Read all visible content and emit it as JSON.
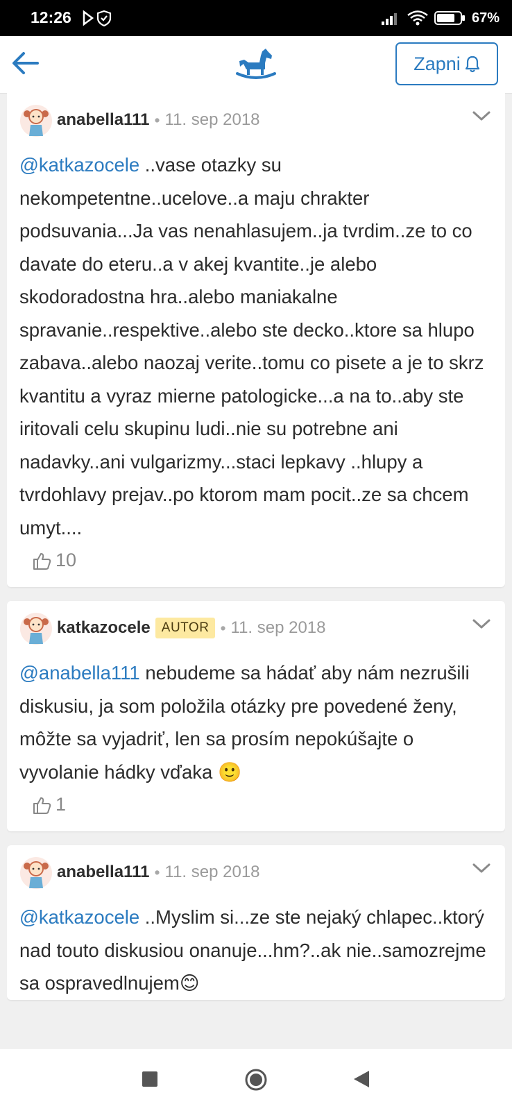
{
  "status_bar": {
    "time": "12:26",
    "battery": "67%"
  },
  "header": {
    "notify_label": "Zapni"
  },
  "comments": [
    {
      "username": "anabella111",
      "date": "11. sep 2018",
      "mention": "@katkazocele",
      "text": " ..vase otazky su nekompetentne..ucelove..a maju chrakter podsuvania...Ja vas nenahlasujem..ja tvrdim..ze to co davate do eteru..a v akej kvantite..je alebo skodoradostna hra..alebo maniakalne spravanie..respektive..alebo ste decko..ktore sa hlupo zabava..alebo naozaj verite..tomu co pisete a je to skrz kvantitu a vyraz mierne patologicke...a na to..aby ste iritovali celu skupinu ludi..nie su potrebne ani nadavky..ani vulgarizmy...staci lepkavy ..hlupy a tvrdohlavy prejav..po ktorom mam pocit..ze sa chcem umyt....",
      "likes": "10"
    },
    {
      "username": "katkazocele",
      "badge": "AUTOR",
      "date": "11. sep 2018",
      "mention": "@anabella111",
      "text": " nebudeme sa hádať aby nám nezrušili diskusiu, ja som položila otázky pre povedené ženy, môžte sa vyjadriť, len sa prosím nepokúšajte o vyvolanie hádky vďaka 🙂",
      "likes": "1"
    },
    {
      "username": "anabella111",
      "date": "11. sep 2018",
      "mention": "@katkazocele",
      "text": " ..Myslim si...ze ste nejaký chlapec..ktorý nad touto diskusiou onanuje...hm?..ak nie..samozrejme sa ospravedlnujem😊"
    }
  ],
  "colors": {
    "accent": "#2b7bc0",
    "badge_bg": "#fde9a1",
    "background": "#f0f0f0"
  },
  "icons": [
    "back-arrow-icon",
    "rocking-horse-logo-icon",
    "bell-icon",
    "chevron-down-icon",
    "thumbs-up-icon",
    "avatar-icon"
  ]
}
